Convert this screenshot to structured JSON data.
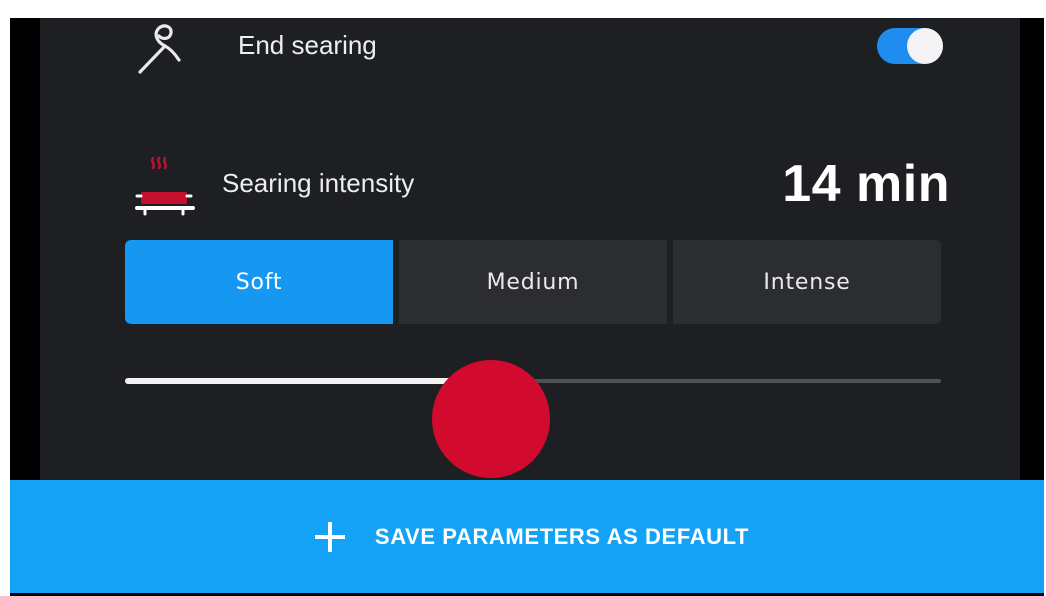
{
  "end_searing": {
    "label": "End searing",
    "icon": "probe-icon",
    "enabled": true
  },
  "searing_intensity": {
    "label": "Searing intensity",
    "icon": "pot-heat-icon",
    "time_value": "14 min"
  },
  "intensity_options": [
    {
      "label": "Soft",
      "selected": true
    },
    {
      "label": "Medium",
      "selected": false
    },
    {
      "label": "Intense",
      "selected": false
    }
  ],
  "slider": {
    "fraction": 0.485
  },
  "save_bar": {
    "label": "SAVE PARAMETERS AS DEFAULT",
    "icon": "plus-icon"
  },
  "colors": {
    "accent": "#1697f2",
    "panel_bg": "#1e1f22",
    "segment_bg": "#2c2d31",
    "heat_red": "#c4102e",
    "touch_indicator": "#d20a2e",
    "save_bar_bg": "#13a2f5"
  }
}
